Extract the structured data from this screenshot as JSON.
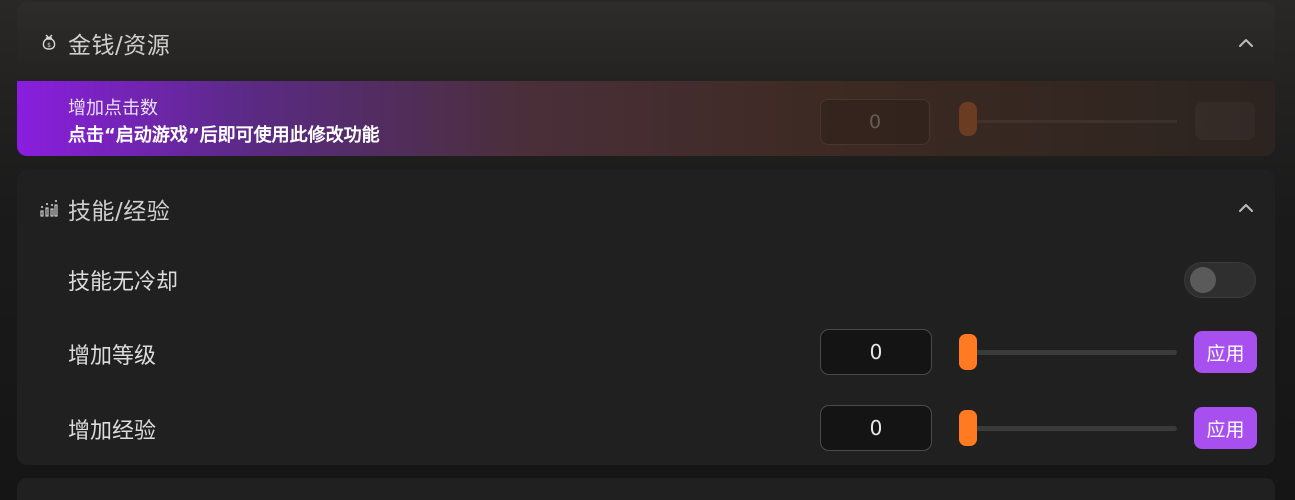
{
  "sections": [
    {
      "title": "金钱/资源",
      "icon": "money-bag-icon",
      "expanded": true,
      "rows": [
        {
          "label": "增加点击数",
          "value": "0",
          "slider_level": 0,
          "disabled": true,
          "overlay_message": "点击“启动游戏”后即可使用此修改功能"
        }
      ]
    },
    {
      "title": "技能/经验",
      "icon": "bar-chart-icon",
      "expanded": true,
      "rows": [
        {
          "label": "技能无冷却",
          "control": "toggle",
          "on": false
        },
        {
          "label": "增加等级",
          "value": "0",
          "slider_level": 0,
          "button": "应用"
        },
        {
          "label": "增加经验",
          "value": "0",
          "slider_level": 0,
          "button": "应用"
        }
      ]
    }
  ],
  "colors": {
    "accent_orange": "#ff7a21",
    "accent_purple": "#a84ff0",
    "overlay_purple": "#8a1ee0"
  }
}
